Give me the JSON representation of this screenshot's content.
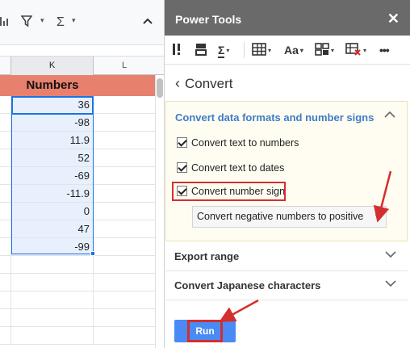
{
  "sheet": {
    "toolbar_icons": [
      "bar-chart-icon",
      "filter-icon",
      "sigma-icon",
      "collapse-icon"
    ],
    "columns": [
      "K",
      "L"
    ],
    "header_cell": "Numbers",
    "values": [
      "36",
      "-98",
      "11.9",
      "52",
      "-69",
      "-11.9",
      "0",
      "47",
      "-99"
    ]
  },
  "panel": {
    "title": "Power Tools",
    "close_glyph": "✕",
    "toolbar_items": [
      "text-tools-icon",
      "clear-icon",
      "sigma-icon",
      "table-icon",
      "font-case-icon",
      "layout-icon",
      "delete-table-icon",
      "more-icon"
    ],
    "font_case_label": "Aa",
    "more_label": "•••",
    "back_label": "Convert",
    "section_main": {
      "title": "Convert data formats and number signs",
      "options": [
        {
          "label": "Convert text to numbers",
          "checked": true
        },
        {
          "label": "Convert text to dates",
          "checked": true
        },
        {
          "label": "Convert number sign",
          "checked": true
        }
      ],
      "dropdown_value": "Convert negative numbers to positive"
    },
    "section_export": "Export range",
    "section_japanese": "Convert Japanese characters",
    "run_label": "Run"
  },
  "colors": {
    "title_bar": "#6a6a6a",
    "header_fill": "#e8806e",
    "selection": "#1a73e8",
    "section_title": "#3d7dc8",
    "run_button": "#4a8af4",
    "annotation": "#d32f2f"
  }
}
